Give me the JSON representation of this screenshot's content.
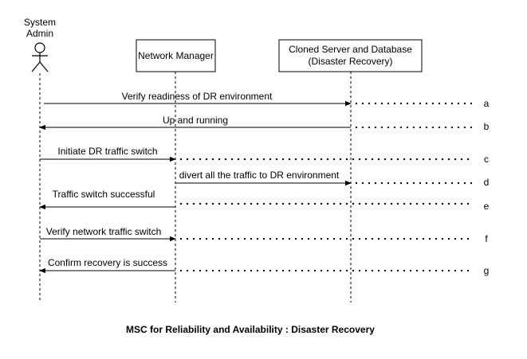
{
  "actor": {
    "name_line1": "System",
    "name_line2": "Admin"
  },
  "participants": {
    "network_manager": "Network Manager",
    "cloned_server_line1": "Cloned Server and Database",
    "cloned_server_line2": "(Disaster Recovery)"
  },
  "messages": [
    {
      "text": "Verify readiness of DR environment",
      "tag": "a"
    },
    {
      "text": "Up and running",
      "tag": "b"
    },
    {
      "text": "Initiate DR traffic switch",
      "tag": "c"
    },
    {
      "text": "divert all the traffic to DR environment",
      "tag": "d"
    },
    {
      "text": "Traffic switch successful",
      "tag": "e"
    },
    {
      "text": "Verify network traffic switch",
      "tag": "f"
    },
    {
      "text": "Confirm recovery is success",
      "tag": "g"
    }
  ],
  "caption": "MSC for Reliability and Availability : Disaster Recovery"
}
